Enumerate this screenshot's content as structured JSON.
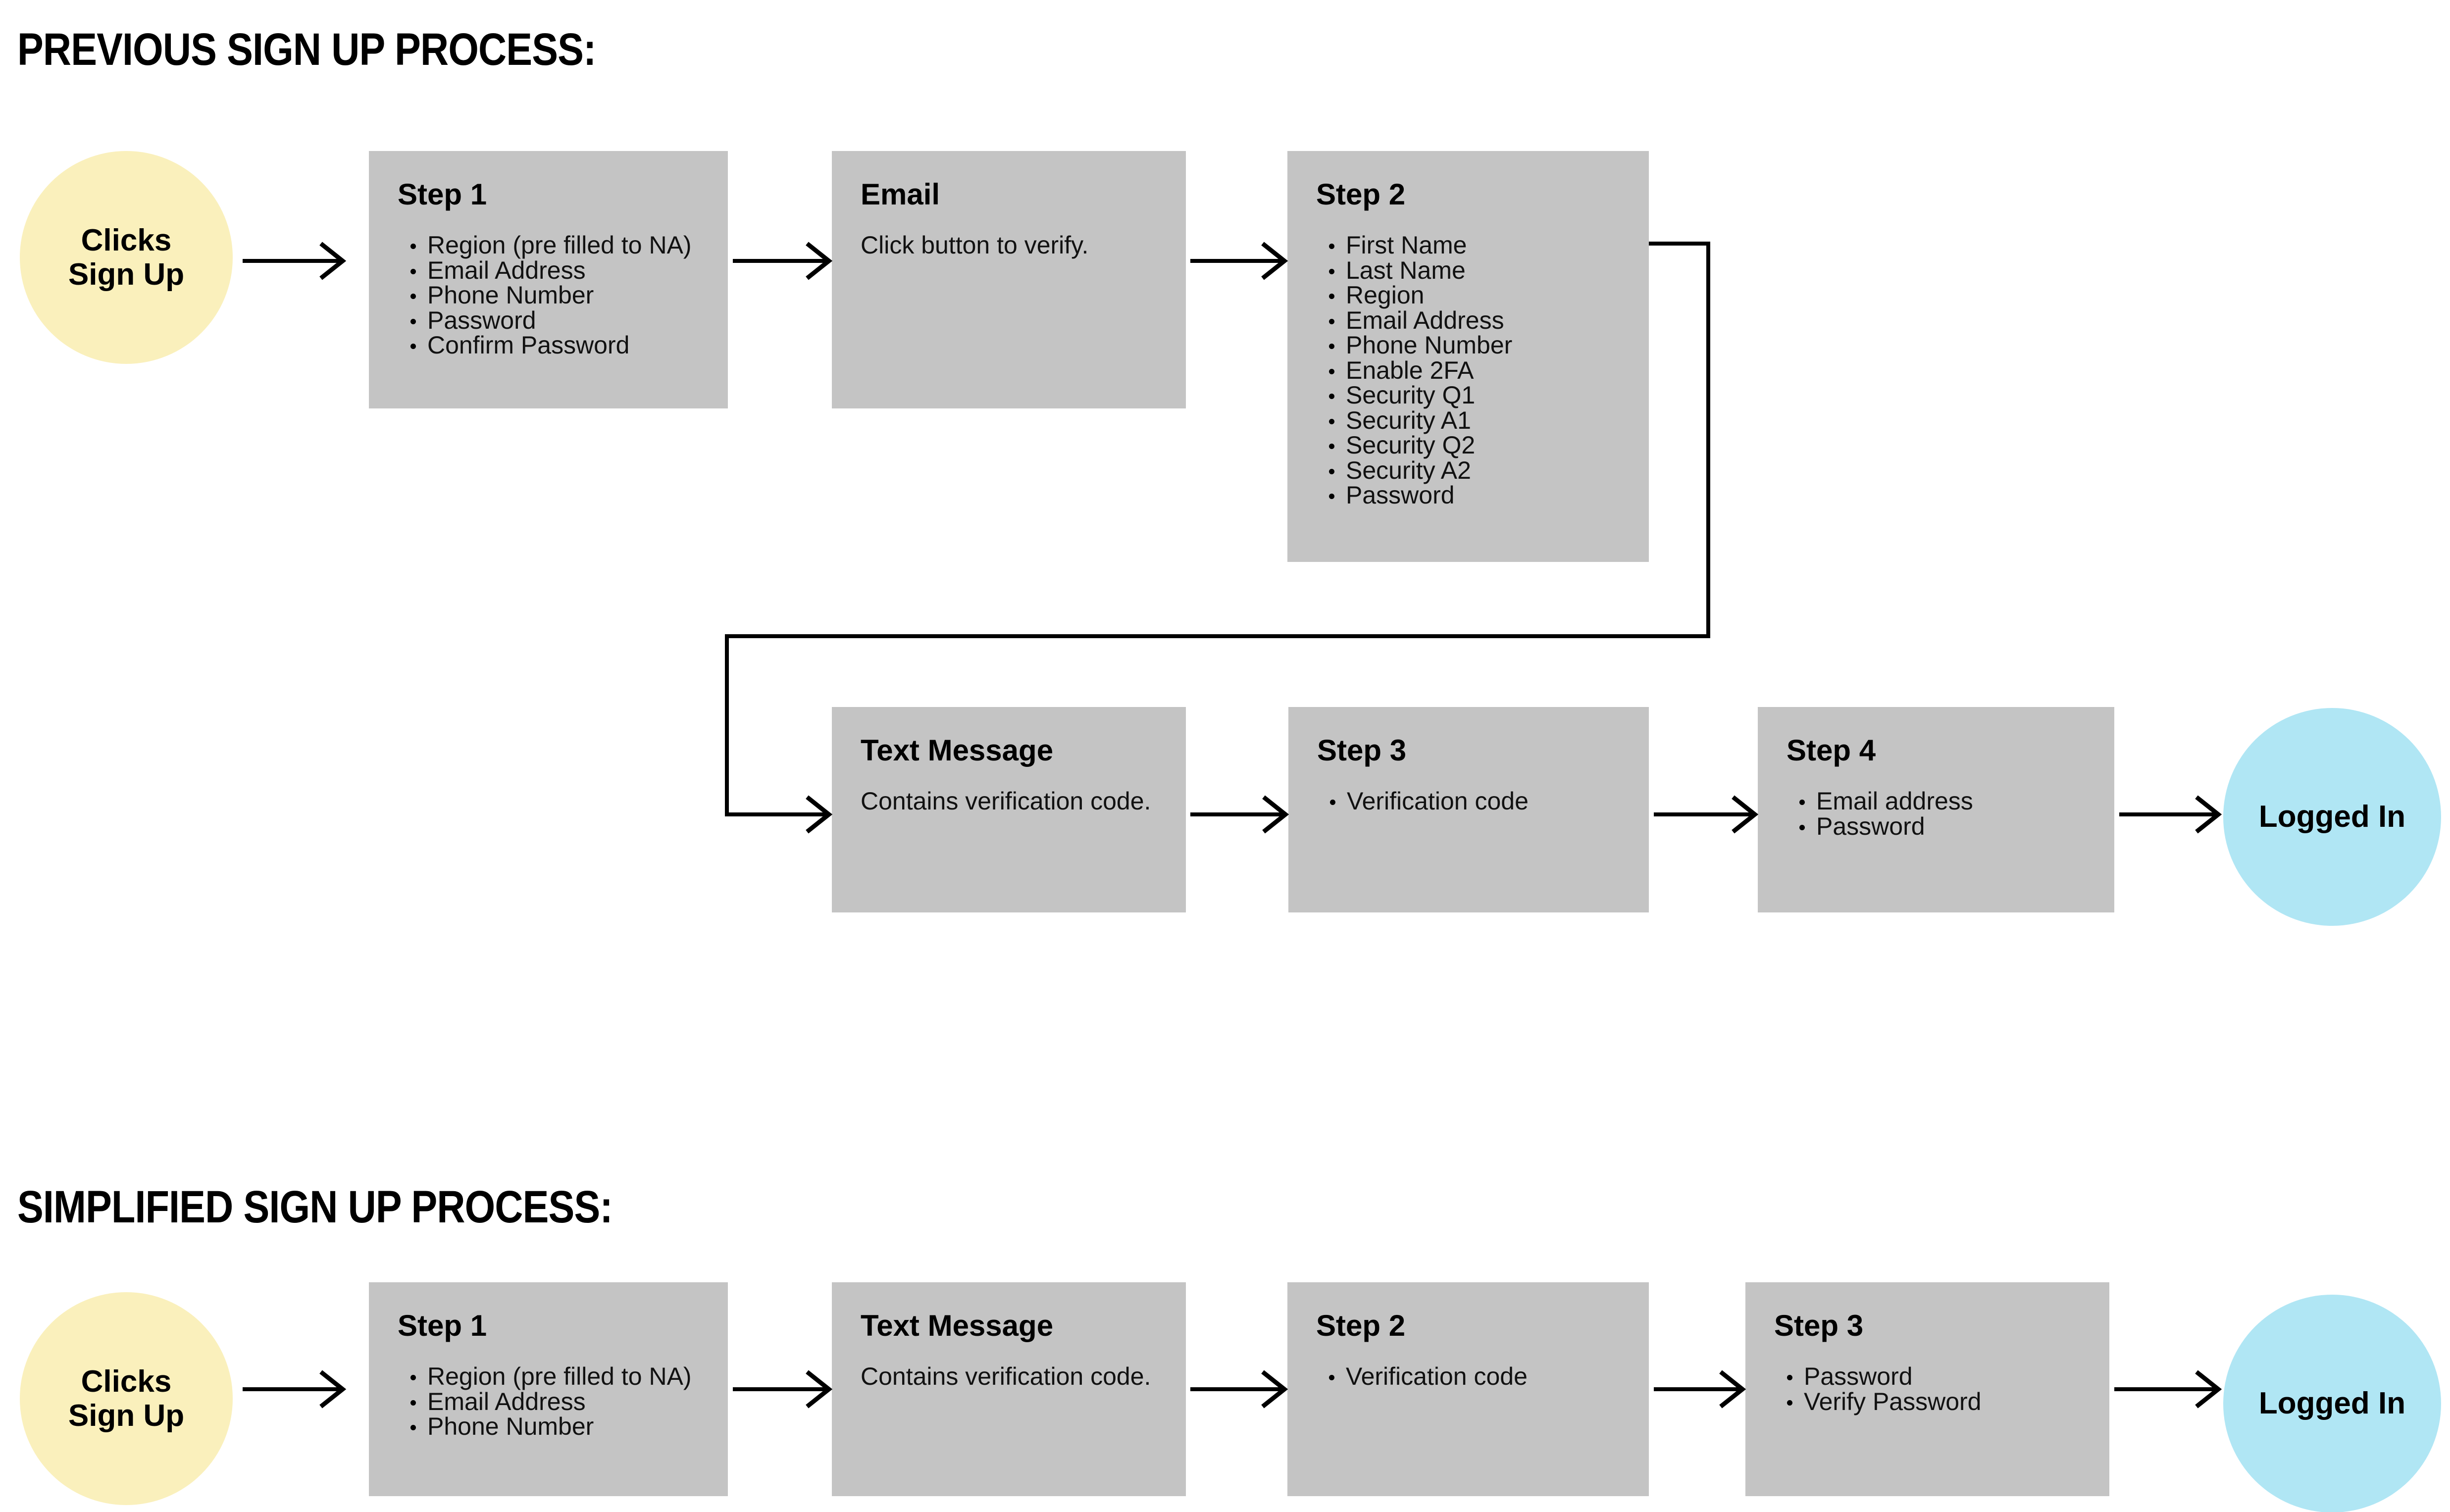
{
  "colors": {
    "background": "#ffffff",
    "box_fill": "#c4c4c4",
    "start_circle": "#faf0bc",
    "end_circle": "#b0e6f4",
    "line": "#000000",
    "text": "#000000"
  },
  "sections": [
    {
      "id": "previous",
      "title": "PREVIOUS SIGN UP PROCESS:",
      "start_node": {
        "label": "Clicks\nSign Up"
      },
      "end_node": {
        "label": "Logged In"
      },
      "nodes": [
        {
          "id": "prev-step-1",
          "title": "Step 1",
          "items": [
            "Region (pre filled to NA)",
            "Email Address",
            "Phone Number",
            "Password",
            "Confirm Password"
          ]
        },
        {
          "id": "prev-email",
          "title": "Email",
          "body": "Click button to verify."
        },
        {
          "id": "prev-step-2",
          "title": "Step 2",
          "items": [
            "First Name",
            "Last Name",
            "Region",
            "Email Address",
            "Phone Number",
            "Enable 2FA",
            "Security Q1",
            "Security A1",
            "Security Q2",
            "Security A2",
            "Password"
          ]
        },
        {
          "id": "prev-text-message",
          "title": "Text Message",
          "body": "Contains verification code."
        },
        {
          "id": "prev-step-3",
          "title": "Step 3",
          "items": [
            "Verification code"
          ]
        },
        {
          "id": "prev-step-4",
          "title": "Step 4",
          "items": [
            "Email address",
            "Password"
          ]
        }
      ]
    },
    {
      "id": "simplified",
      "title": "SIMPLIFIED SIGN UP PROCESS:",
      "start_node": {
        "label": "Clicks\nSign Up"
      },
      "end_node": {
        "label": "Logged In"
      },
      "nodes": [
        {
          "id": "simp-step-1",
          "title": "Step 1",
          "items": [
            "Region (pre filled to NA)",
            "Email Address",
            "Phone Number"
          ]
        },
        {
          "id": "simp-text-message",
          "title": "Text Message",
          "body": "Contains verification code."
        },
        {
          "id": "simp-step-2",
          "title": "Step 2",
          "items": [
            "Verification code"
          ]
        },
        {
          "id": "simp-step-3",
          "title": "Step 3",
          "items": [
            "Password",
            "Verify Password"
          ]
        }
      ]
    }
  ]
}
